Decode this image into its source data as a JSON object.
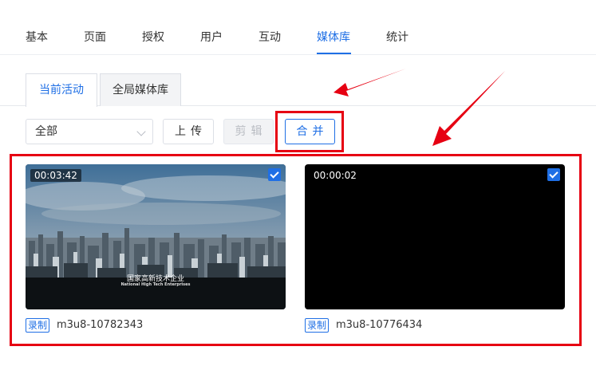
{
  "top_tabs": {
    "items": [
      {
        "label": "基本"
      },
      {
        "label": "页面"
      },
      {
        "label": "授权"
      },
      {
        "label": "用户"
      },
      {
        "label": "互动"
      },
      {
        "label": "媒体库"
      },
      {
        "label": "统计"
      }
    ],
    "active": "媒体库"
  },
  "sub_tabs": {
    "items": [
      {
        "label": "当前活动"
      },
      {
        "label": "全局媒体库"
      }
    ],
    "active": "当前活动"
  },
  "toolbar": {
    "filter_value": "全部",
    "upload_label": "上传",
    "clip_label": "剪辑",
    "merge_label": "合并"
  },
  "media": [
    {
      "duration": "00:03:42",
      "selected": true,
      "thumbnail_caption_cn": "国家高新技术企业",
      "thumbnail_caption_en": "National High Tech Enterprises",
      "tag": "录制",
      "name": "m3u8-10782343"
    },
    {
      "duration": "00:00:02",
      "selected": true,
      "tag": "录制",
      "name": "m3u8-10776434"
    }
  ],
  "colors": {
    "accent": "#1f6fe5",
    "highlight": "#e60012"
  },
  "icons": [
    "chevron-down-icon",
    "checkbox-checked-icon"
  ]
}
